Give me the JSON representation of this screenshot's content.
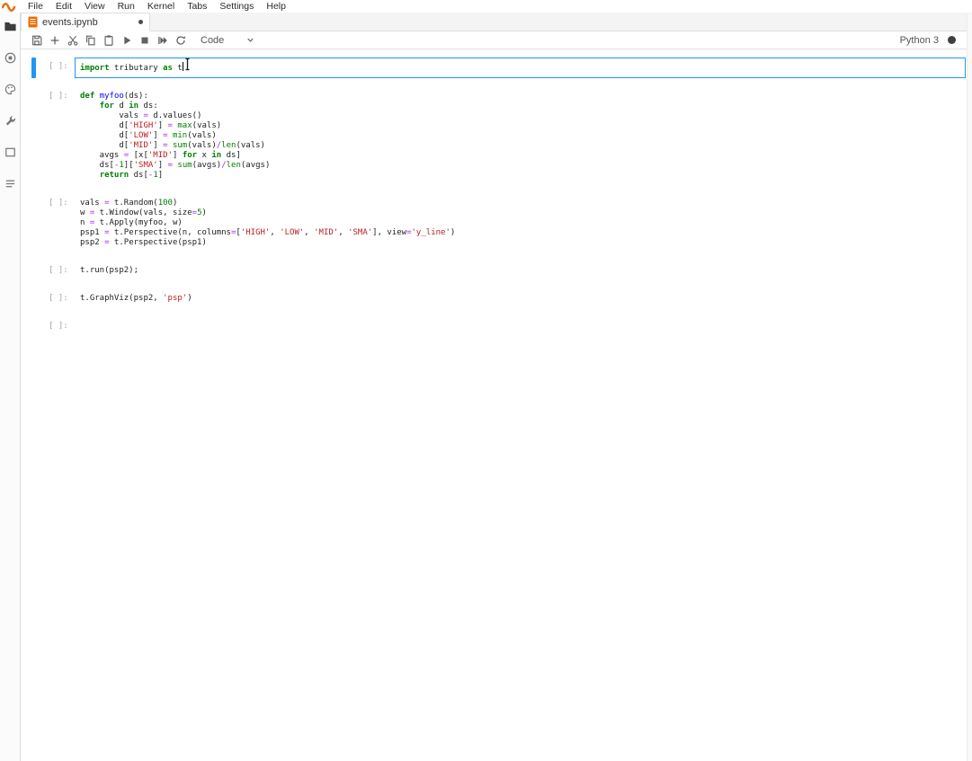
{
  "menu": {
    "items": [
      "File",
      "Edit",
      "View",
      "Run",
      "Kernel",
      "Tabs",
      "Settings",
      "Help"
    ]
  },
  "tab": {
    "label": "events.ipynb",
    "icon": "notebook-icon",
    "dirty": true
  },
  "toolbar": {
    "buttons": [
      "save",
      "insert-cell-below",
      "cut-cells",
      "copy-cells",
      "paste-cells",
      "run-cell",
      "interrupt-kernel",
      "restart-and-run-all",
      "restart-kernel"
    ],
    "cell_type": "Code",
    "kernel_name": "Python 3",
    "kernel_status_icon": "filled-circle"
  },
  "sidebar": {
    "icons": [
      "file-browser",
      "running-kernels",
      "command-palette",
      "notebook-tools",
      "open-tabs",
      "table-of-contents"
    ]
  },
  "colors": {
    "active_cell_border": "#2196f3",
    "keyword": "#008000",
    "string": "#ba2121",
    "number": "#008000",
    "operator": "#aa22ff",
    "definition": "#0000ff",
    "tab_icon": "#ef6c00"
  },
  "notebook": {
    "cells": [
      {
        "prompt": "[ ]:",
        "active": true,
        "caret": true,
        "lines": [
          [
            [
              "k",
              "import"
            ],
            [
              "w",
              " tributary "
            ],
            [
              "k",
              "as"
            ],
            [
              "w",
              " t"
            ]
          ]
        ]
      },
      {
        "prompt": "[ ]:",
        "active": false,
        "lines": [
          [
            [
              "k",
              "def"
            ],
            [
              "w",
              " "
            ],
            [
              "d",
              "myfoo"
            ],
            [
              "w",
              "(ds):"
            ]
          ],
          [
            [
              "w",
              "    "
            ],
            [
              "k",
              "for"
            ],
            [
              "w",
              " d "
            ],
            [
              "k",
              "in"
            ],
            [
              "w",
              " ds:"
            ]
          ],
          [
            [
              "w",
              "        vals "
            ],
            [
              "o",
              "="
            ],
            [
              "w",
              " d.values()"
            ]
          ],
          [
            [
              "w",
              "        d["
            ],
            [
              "s",
              "'HIGH'"
            ],
            [
              "w",
              "] "
            ],
            [
              "o",
              "="
            ],
            [
              "w",
              " "
            ],
            [
              "b",
              "max"
            ],
            [
              "w",
              "(vals)"
            ]
          ],
          [
            [
              "w",
              "        d["
            ],
            [
              "s",
              "'LOW'"
            ],
            [
              "w",
              "] "
            ],
            [
              "o",
              "="
            ],
            [
              "w",
              " "
            ],
            [
              "b",
              "min"
            ],
            [
              "w",
              "(vals)"
            ]
          ],
          [
            [
              "w",
              "        d["
            ],
            [
              "s",
              "'MID'"
            ],
            [
              "w",
              "] "
            ],
            [
              "o",
              "="
            ],
            [
              "w",
              " "
            ],
            [
              "b",
              "sum"
            ],
            [
              "w",
              "(vals)"
            ],
            [
              "o",
              "/"
            ],
            [
              "b",
              "len"
            ],
            [
              "w",
              "(vals)"
            ]
          ],
          [
            [
              "w",
              "    avgs "
            ],
            [
              "o",
              "="
            ],
            [
              "w",
              " [x["
            ],
            [
              "s",
              "'MID'"
            ],
            [
              "w",
              "] "
            ],
            [
              "k",
              "for"
            ],
            [
              "w",
              " x "
            ],
            [
              "k",
              "in"
            ],
            [
              "w",
              " ds]"
            ]
          ],
          [
            [
              "w",
              "    ds["
            ],
            [
              "o",
              "-"
            ],
            [
              "n",
              "1"
            ],
            [
              "w",
              "]["
            ],
            [
              "s",
              "'SMA'"
            ],
            [
              "w",
              "] "
            ],
            [
              "o",
              "="
            ],
            [
              "w",
              " "
            ],
            [
              "b",
              "sum"
            ],
            [
              "w",
              "(avgs)"
            ],
            [
              "o",
              "/"
            ],
            [
              "b",
              "len"
            ],
            [
              "w",
              "(avgs)"
            ]
          ],
          [
            [
              "w",
              "    "
            ],
            [
              "k",
              "return"
            ],
            [
              "w",
              " ds["
            ],
            [
              "o",
              "-"
            ],
            [
              "n",
              "1"
            ],
            [
              "w",
              "]"
            ]
          ]
        ]
      },
      {
        "prompt": "[ ]:",
        "active": false,
        "lines": [
          [
            [
              "w",
              "vals "
            ],
            [
              "o",
              "="
            ],
            [
              "w",
              " t.Random("
            ],
            [
              "n",
              "100"
            ],
            [
              "w",
              ")"
            ]
          ],
          [
            [
              "w",
              "w "
            ],
            [
              "o",
              "="
            ],
            [
              "w",
              " t.Window(vals, size"
            ],
            [
              "o",
              "="
            ],
            [
              "n",
              "5"
            ],
            [
              "w",
              ")"
            ]
          ],
          [
            [
              "w",
              "n "
            ],
            [
              "o",
              "="
            ],
            [
              "w",
              " t.Apply(myfoo, w)"
            ]
          ],
          [
            [
              "w",
              "psp1 "
            ],
            [
              "o",
              "="
            ],
            [
              "w",
              " t.Perspective(n, columns"
            ],
            [
              "o",
              "="
            ],
            [
              "w",
              "["
            ],
            [
              "s",
              "'HIGH'"
            ],
            [
              "w",
              ", "
            ],
            [
              "s",
              "'LOW'"
            ],
            [
              "w",
              ", "
            ],
            [
              "s",
              "'MID'"
            ],
            [
              "w",
              ", "
            ],
            [
              "s",
              "'SMA'"
            ],
            [
              "w",
              "], view"
            ],
            [
              "o",
              "="
            ],
            [
              "s",
              "'y_line'"
            ],
            [
              "w",
              ")"
            ]
          ],
          [
            [
              "w",
              "psp2 "
            ],
            [
              "o",
              "="
            ],
            [
              "w",
              " t.Perspective(psp1)"
            ]
          ]
        ]
      },
      {
        "prompt": "[ ]:",
        "active": false,
        "lines": [
          [
            [
              "w",
              "t.run(psp2);"
            ]
          ]
        ]
      },
      {
        "prompt": "[ ]:",
        "active": false,
        "lines": [
          [
            [
              "w",
              "t.GraphViz(psp2, "
            ],
            [
              "s",
              "'psp'"
            ],
            [
              "w",
              ")"
            ]
          ]
        ]
      },
      {
        "prompt": "[ ]:",
        "active": false,
        "lines": [
          []
        ]
      }
    ]
  }
}
